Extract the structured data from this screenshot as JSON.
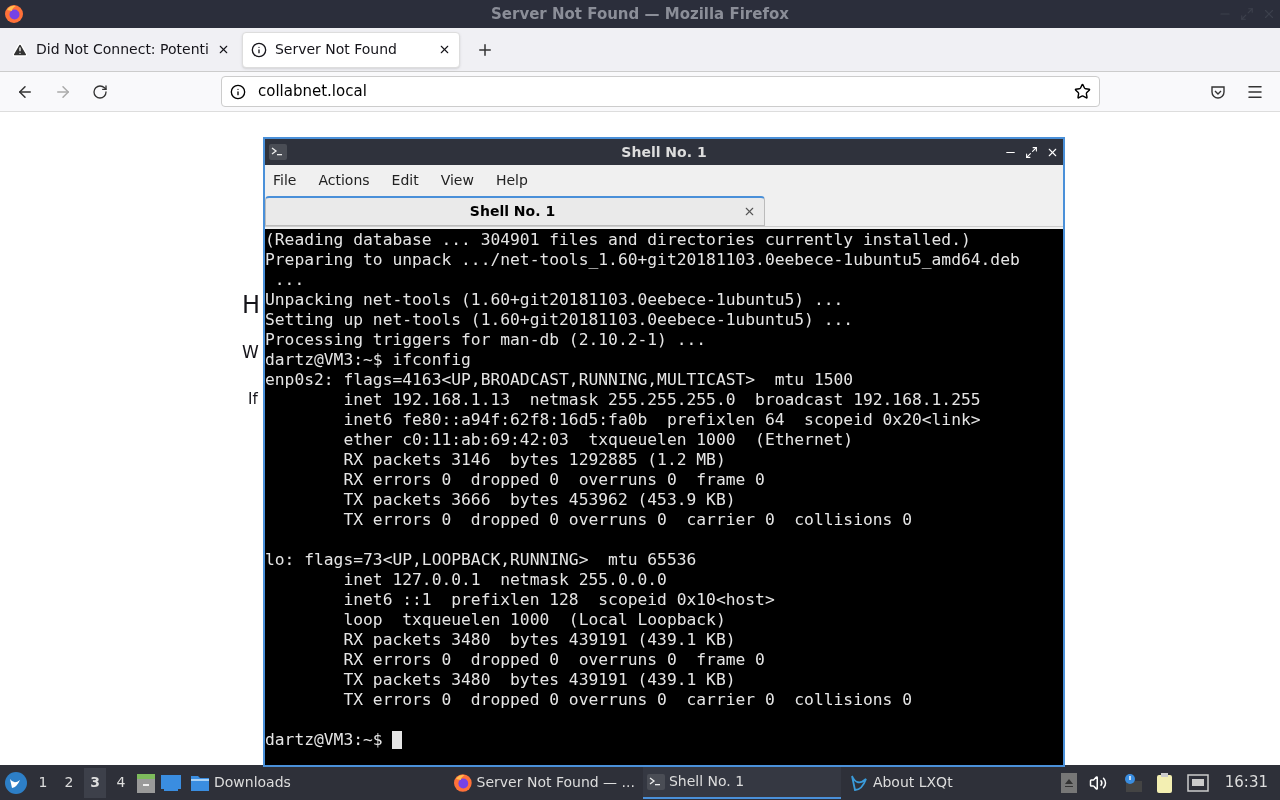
{
  "window": {
    "title": "Server Not Found — Mozilla Firefox"
  },
  "tabs": [
    {
      "label": "Did Not Connect: Potenti",
      "kind": "warning",
      "selected": false
    },
    {
      "label": "Server Not Found",
      "kind": "info",
      "selected": true
    }
  ],
  "address_bar": {
    "value": "collabnet.local"
  },
  "page": {
    "lines": [
      "H",
      "W",
      "If"
    ]
  },
  "terminal": {
    "title": "Shell No. 1",
    "menu": [
      "File",
      "Actions",
      "Edit",
      "View",
      "Help"
    ],
    "tab": "Shell No. 1",
    "lines": [
      "(Reading database ... 304901 files and directories currently installed.)",
      "Preparing to unpack .../net-tools_1.60+git20181103.0eebece-1ubuntu5_amd64.deb",
      " ...",
      "Unpacking net-tools (1.60+git20181103.0eebece-1ubuntu5) ...",
      "Setting up net-tools (1.60+git20181103.0eebece-1ubuntu5) ...",
      "Processing triggers for man-db (2.10.2-1) ...",
      "dartz@VM3:~$ ifconfig",
      "enp0s2: flags=4163<UP,BROADCAST,RUNNING,MULTICAST>  mtu 1500",
      "        inet 192.168.1.13  netmask 255.255.255.0  broadcast 192.168.1.255",
      "        inet6 fe80::a94f:62f8:16d5:fa0b  prefixlen 64  scopeid 0x20<link>",
      "        ether c0:11:ab:69:42:03  txqueuelen 1000  (Ethernet)",
      "        RX packets 3146  bytes 1292885 (1.2 MB)",
      "        RX errors 0  dropped 0  overruns 0  frame 0",
      "        TX packets 3666  bytes 453962 (453.9 KB)",
      "        TX errors 0  dropped 0 overruns 0  carrier 0  collisions 0"
    ],
    "lines_after_gap": [
      "lo: flags=73<UP,LOOPBACK,RUNNING>  mtu 65536",
      "        inet 127.0.0.1  netmask 255.0.0.0",
      "        inet6 ::1  prefixlen 128  scopeid 0x10<host>",
      "        loop  txqueuelen 1000  (Local Loopback)",
      "        RX packets 3480  bytes 439191 (439.1 KB)",
      "        RX errors 0  dropped 0  overruns 0  frame 0",
      "        TX packets 3480  bytes 439191 (439.1 KB)",
      "        TX errors 0  dropped 0 overruns 0  carrier 0  collisions 0"
    ],
    "prompt": "dartz@VM3:~$ "
  },
  "taskbar": {
    "desktops": [
      {
        "label": "1",
        "selected": false
      },
      {
        "label": "2",
        "selected": false
      },
      {
        "label": "3",
        "selected": true
      },
      {
        "label": "4",
        "selected": false
      }
    ],
    "tasks": [
      {
        "label": "Downloads",
        "kind": "folder",
        "selected": false
      },
      {
        "label": "Server Not Found — ...",
        "kind": "firefox",
        "selected": false
      },
      {
        "label": "Shell No. 1",
        "kind": "terminal",
        "selected": true
      },
      {
        "label": "About LXQt",
        "kind": "lxqt",
        "selected": false
      }
    ],
    "clock": "16:31"
  }
}
